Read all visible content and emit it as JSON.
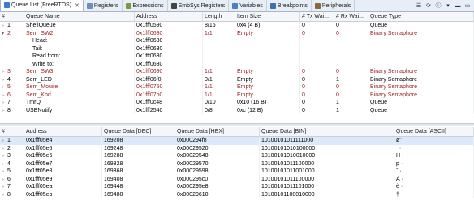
{
  "tabs": [
    {
      "label": "Queue List (FreeRTOS)",
      "icon": "queue-list-icon",
      "color": "#3a7bd5",
      "active": true
    },
    {
      "label": "Registers",
      "icon": "registers-icon",
      "color": "#6a8fb8"
    },
    {
      "label": "Expressions",
      "icon": "expressions-icon",
      "color": "#7a9a3c"
    },
    {
      "label": "EmbSys Registers",
      "icon": "embsys-icon",
      "color": "#444444"
    },
    {
      "label": "Variables",
      "icon": "variables-icon",
      "color": "#4a7fc0"
    },
    {
      "label": "Breakpoints",
      "icon": "breakpoints-icon",
      "color": "#3f6fb0"
    },
    {
      "label": "Peripherals",
      "icon": "peripherals-icon",
      "color": "#8a6a3a"
    }
  ],
  "queue_table": {
    "headers": [
      "#",
      "Queue Name",
      "Address",
      "Length",
      "Item Size",
      "# Tx Wai...",
      "# Rx Wai...",
      "Queue Type"
    ],
    "rows": [
      {
        "num": "1",
        "name": "ShellQueue",
        "address": "0x1fff0590",
        "length": "8/16",
        "item_size": "0x4 (4 B)",
        "tx": "0",
        "rx": "0",
        "type": "Queue",
        "expander": "closed",
        "red": false
      },
      {
        "num": "2",
        "name": "Sem_SW2",
        "address": "0x1fff0630",
        "length": "1/1",
        "item_size": "Empty",
        "tx": "0",
        "rx": "0",
        "type": "Binary Semaphore",
        "expander": "open",
        "red": true
      },
      {
        "num": "",
        "name": "Head:",
        "address": "0x1fff0630",
        "length": "",
        "item_size": "",
        "tx": "",
        "rx": "",
        "type": "",
        "expander": "",
        "red": false,
        "indent": true
      },
      {
        "num": "",
        "name": "Tail:",
        "address": "0x1fff0630",
        "length": "",
        "item_size": "",
        "tx": "",
        "rx": "",
        "type": "",
        "expander": "",
        "red": false,
        "indent": true
      },
      {
        "num": "",
        "name": "Read from:",
        "address": "0x1fff0630",
        "length": "",
        "item_size": "",
        "tx": "",
        "rx": "",
        "type": "",
        "expander": "",
        "red": false,
        "indent": true
      },
      {
        "num": "",
        "name": "Write to:",
        "address": "0x1fff0630",
        "length": "",
        "item_size": "",
        "tx": "",
        "rx": "",
        "type": "",
        "expander": "",
        "red": false,
        "indent": true
      },
      {
        "num": "3",
        "name": "Sem_SW3",
        "address": "0x1fff0690",
        "length": "1/1",
        "item_size": "Empty",
        "tx": "0",
        "rx": "0",
        "type": "Binary Semaphore",
        "expander": "closed",
        "red": true
      },
      {
        "num": "4",
        "name": "Sem_LED",
        "address": "0x1fff06f0",
        "length": "0/1",
        "item_size": "Empty",
        "tx": "0",
        "rx": "1",
        "type": "Binary Semaphore",
        "expander": "closed",
        "red": false
      },
      {
        "num": "5",
        "name": "Sem_Mouse",
        "address": "0x1fff0750",
        "length": "1/1",
        "item_size": "Empty",
        "tx": "0",
        "rx": "0",
        "type": "Binary Semaphore",
        "expander": "closed",
        "red": true
      },
      {
        "num": "6",
        "name": "Sem_Kbd",
        "address": "0x1fff07b0",
        "length": "1/1",
        "item_size": "Empty",
        "tx": "0",
        "rx": "0",
        "type": "Binary Semaphore",
        "expander": "closed",
        "red": true
      },
      {
        "num": "7",
        "name": "TmrQ",
        "address": "0x1fff0c48",
        "length": "0/10",
        "item_size": "0x10 (16 B)",
        "tx": "0",
        "rx": "1",
        "type": "Queue",
        "expander": "closed",
        "red": false
      },
      {
        "num": "8",
        "name": "USBNotify",
        "address": "0x1fff2540",
        "length": "0/8",
        "item_size": "0xc (12 B)",
        "tx": "0",
        "rx": "1",
        "type": "Queue",
        "expander": "closed",
        "red": false
      }
    ]
  },
  "data_table": {
    "headers": [
      "#",
      "Address",
      "Queue Data [DEC]",
      "Queue Data [HEX]",
      "Queue Data [BIN]",
      "Queue Data [ASCII]"
    ],
    "rows": [
      {
        "num": "1",
        "address": "0x1fff05e4",
        "dec": "169208",
        "hex": "0x000294f8",
        "bin": "10100101011111000",
        "ascii": "ø\"",
        "selected": true
      },
      {
        "num": "2",
        "address": "0x1fff05e5",
        "dec": "169248",
        "hex": "0x00029520",
        "bin": "10100101010100000",
        "ascii": "  ·"
      },
      {
        "num": "3",
        "address": "0x1fff05e6",
        "dec": "169288",
        "hex": "0x00029548",
        "bin": "10100101010010000",
        "ascii": "H ·"
      },
      {
        "num": "4",
        "address": "0x1fff05e7",
        "dec": "169328",
        "hex": "0x00029570",
        "bin": "10100101011100000",
        "ascii": "p ·"
      },
      {
        "num": "5",
        "address": "0x1fff05e8",
        "dec": "169368",
        "hex": "0x00029598",
        "bin": "10100101011001000",
        "ascii": "˜ ·"
      },
      {
        "num": "6",
        "address": "0x1fff05e9",
        "dec": "169408",
        "hex": "0x000295c0",
        "bin": "10100101011100000",
        "ascii": "À ·"
      },
      {
        "num": "7",
        "address": "0x1fff05ea",
        "dec": "169448",
        "hex": "0x000295e8",
        "bin": "10100101011101000",
        "ascii": "è ·"
      },
      {
        "num": "8",
        "address": "0x1fff05eb",
        "dec": "169488",
        "hex": "0x00029610",
        "bin": "10100101100010000",
        "ascii": "†"
      }
    ]
  },
  "colors": {
    "red_text": "#9a1f1f",
    "selection": "#dbe9f8",
    "tabbar": "#e8eef6"
  }
}
